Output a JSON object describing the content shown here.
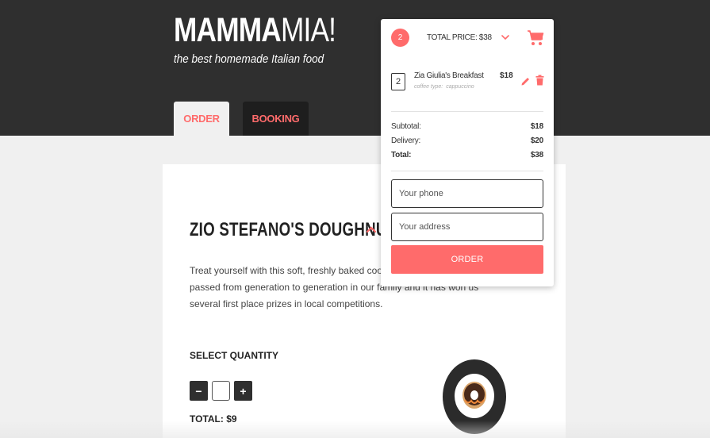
{
  "header": {
    "logo_bold": "MAMMA",
    "logo_light": "MIA!",
    "tagline": "the best homemade Italian food"
  },
  "tabs": {
    "order": "ORDER",
    "booking": "BOOKING"
  },
  "product": {
    "title": "ZIO STEFANO'S DOUGHNUT",
    "description": "Treat yourself with this soft, freshly baked cookie. The recipe has been passed from generation to generation in our family and it has won us several first place prizes in local competitions.",
    "quantity_label": "SELECT QUANTITY",
    "minus": "−",
    "plus": "+",
    "quantity_value": "",
    "total": "TOTAL: $9"
  },
  "cart": {
    "count": "2",
    "total_price": "TOTAL PRICE: $38",
    "item": {
      "qty": "2",
      "name": "Zia Giulia's Breakfast",
      "option_label": "coffee type:",
      "option_value": "cappuccino",
      "price": "$18"
    },
    "summary": [
      {
        "label": "Subtotal:",
        "value": "$18"
      },
      {
        "label": "Delivery:",
        "value": "$20"
      },
      {
        "label": "Total:",
        "value": "$38"
      }
    ],
    "phone_placeholder": "Your phone",
    "address_placeholder": "Your address",
    "order_button": "ORDER"
  },
  "colors": {
    "accent": "#ff6b6b",
    "header_bg": "#2f2f2f",
    "page_bg": "#f0f0f0"
  }
}
